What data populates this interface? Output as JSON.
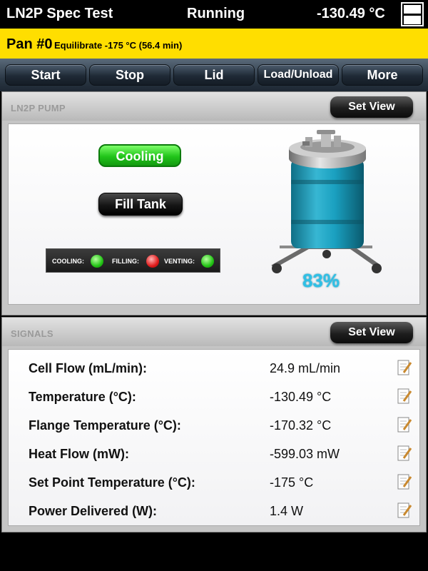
{
  "header": {
    "app_title": "LN2P Spec Test",
    "status": "Running",
    "temperature": "-130.49 °C",
    "layout_icon": "split-layout-icon"
  },
  "pan": {
    "number": "Pan #0",
    "step": "Equilibrate -175 °C (56.4 min)"
  },
  "nav": {
    "start": "Start",
    "stop": "Stop",
    "lid": "Lid",
    "load_unload": "Load/Unload",
    "more": "More"
  },
  "pump_panel": {
    "title": "LN2P PUMP",
    "set_view": "Set View",
    "cooling_button": "Cooling",
    "fill_tank_button": "Fill Tank",
    "indicators": {
      "cooling": {
        "label": "COOLING:",
        "state": "green"
      },
      "filling": {
        "label": "FILLING:",
        "state": "red"
      },
      "venting": {
        "label": "VENTING:",
        "state": "green"
      }
    },
    "tank_level": "83%"
  },
  "signals_panel": {
    "title": "SIGNALS",
    "set_view": "Set View",
    "rows": [
      {
        "label": "Cell Flow (mL/min):",
        "value": "24.9 mL/min"
      },
      {
        "label": "Temperature (°C):",
        "value": "-130.49 °C"
      },
      {
        "label": "Flange Temperature (°C):",
        "value": "-170.32 °C"
      },
      {
        "label": "Heat Flow (mW):",
        "value": "-599.03 mW"
      },
      {
        "label": "Set Point Temperature (°C):",
        "value": "-175 °C"
      },
      {
        "label": "Power Delivered (W):",
        "value": "1.4 W"
      }
    ]
  },
  "colors": {
    "accent_yellow": "#ffde00",
    "cooling_green": "#21c41a",
    "led_red": "#e01b1b",
    "tank_blue": "#2ec0e6"
  }
}
